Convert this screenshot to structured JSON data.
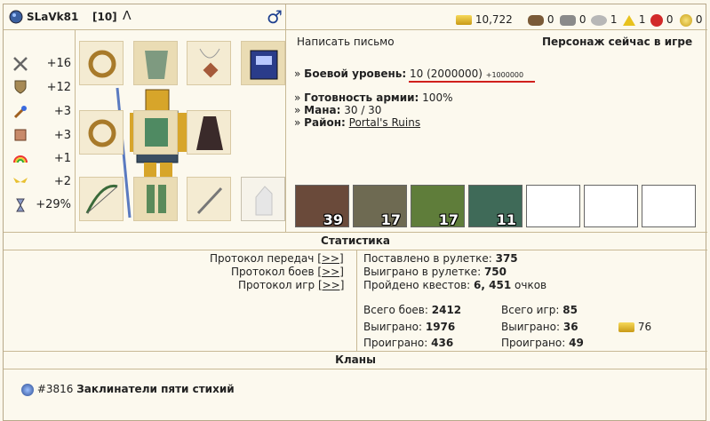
{
  "header": {
    "nickname": "SLaVk81",
    "level_badge": "[10]",
    "resources": [
      {
        "icon": "gold-icon",
        "value": "10,722"
      },
      {
        "icon": "wood-icon",
        "value": "0"
      },
      {
        "icon": "ore-icon",
        "value": "0"
      },
      {
        "icon": "mercury-icon",
        "value": "1"
      },
      {
        "icon": "sulfur-icon",
        "value": "1"
      },
      {
        "icon": "crystal-icon",
        "value": "0"
      },
      {
        "icon": "gems-icon",
        "value": "0"
      }
    ]
  },
  "stats": [
    {
      "icon": "attack-sword-icon",
      "value": "+16"
    },
    {
      "icon": "defense-shield-icon",
      "value": "+12"
    },
    {
      "icon": "spellpower-wand-icon",
      "value": "+3"
    },
    {
      "icon": "knowledge-book-icon",
      "value": "+3"
    },
    {
      "icon": "luck-rainbow-icon",
      "value": "+1"
    },
    {
      "icon": "morale-wings-icon",
      "value": "+2"
    },
    {
      "icon": "initiative-hourglass-icon",
      "value": "+29%"
    }
  ],
  "info": {
    "write_letter": "Написать письмо",
    "online_status": "Персонаж сейчас в игре",
    "combat_label": "Боевой уровень:",
    "combat_value": "10 (2000000)",
    "combat_extra": "+1000000",
    "army_label": "Готовность армии:",
    "army_value": "100%",
    "mana_label": "Мана:",
    "mana_value": "30 / 30",
    "district_label": "Район:",
    "district_value": "Portal's Ruins",
    "bullet": "»"
  },
  "army": [
    {
      "name": "elf-unit",
      "count": "39"
    },
    {
      "name": "dwarf-rider-unit",
      "count": "17"
    },
    {
      "name": "green-dragon-unit",
      "count": "17"
    },
    {
      "name": "jade-dragon-unit",
      "count": "11"
    },
    {
      "name": "empty",
      "count": ""
    },
    {
      "name": "empty",
      "count": ""
    },
    {
      "name": "empty",
      "count": ""
    }
  ],
  "stats_section": {
    "title": "Статистика",
    "links": [
      {
        "label": "Протокол передач",
        "action": "[>>]"
      },
      {
        "label": "Протокол боев",
        "action": "[>>]"
      },
      {
        "label": "Протокол игр",
        "action": "[>>]"
      }
    ],
    "roulette_bet_label": "Поставлено в рулетке:",
    "roulette_bet_value": "375",
    "roulette_won_label": "Выиграно в рулетке:",
    "roulette_won_value": "750",
    "quests_label": "Пройдено квестов:",
    "quests_value": "6, 451",
    "quests_suffix": "очков",
    "battles_total_label": "Всего боев:",
    "battles_total_value": "2412",
    "battles_won_label": "Выиграно:",
    "battles_won_value": "1976",
    "battles_lost_label": "Проиграно:",
    "battles_lost_value": "436",
    "games_total_label": "Всего игр:",
    "games_total_value": "85",
    "games_won_label": "Выиграно:",
    "games_won_value": "36",
    "games_lost_label": "Проиграно:",
    "games_lost_value": "49",
    "games_gold_value": "76"
  },
  "clans_section": {
    "title": "Кланы",
    "clan_id": "#3816",
    "clan_name": "Заклинатели пяти стихий"
  }
}
